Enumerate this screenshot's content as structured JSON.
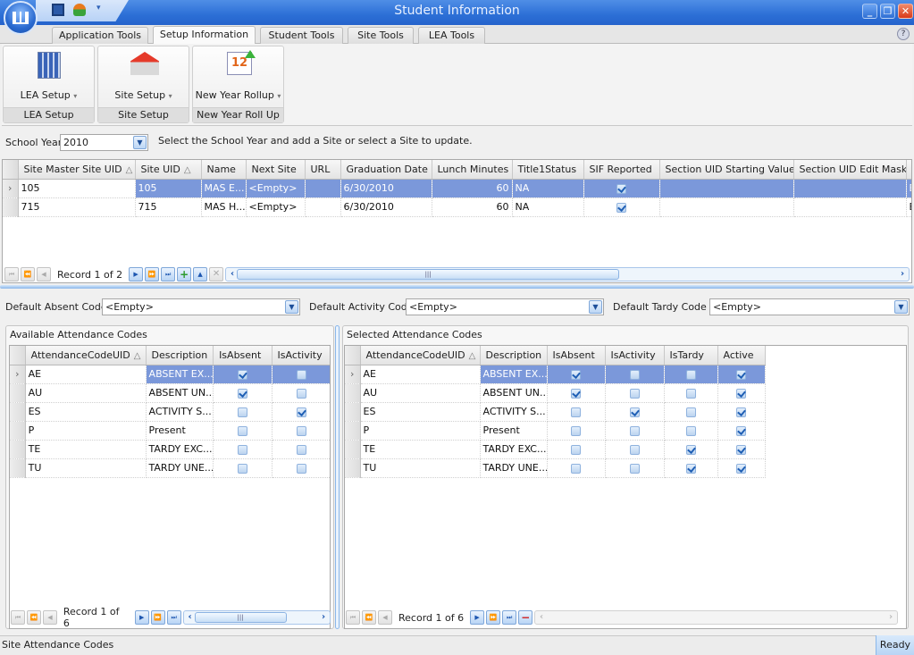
{
  "window": {
    "title": "Student Information",
    "controls": {
      "minimize": "_",
      "restore": "❐",
      "close": "✕"
    }
  },
  "quick_access": {
    "icons": [
      "save-icon",
      "user-icon",
      "customize-icon"
    ]
  },
  "tabs": [
    {
      "label": "Application Tools",
      "active": false
    },
    {
      "label": "Setup Information",
      "active": true
    },
    {
      "label": "Student Tools",
      "active": false
    },
    {
      "label": "Site Tools",
      "active": false
    },
    {
      "label": "LEA Tools",
      "active": false
    }
  ],
  "ribbon": {
    "groups": [
      {
        "button": "LEA Setup",
        "group_label": "LEA Setup",
        "icon": "building-icon"
      },
      {
        "button": "Site Setup",
        "group_label": "Site Setup",
        "icon": "houses-icon"
      },
      {
        "button": "New Year Rollup",
        "group_label": "New Year Roll Up",
        "icon": "calendar-icon"
      }
    ],
    "dropdown_glyph": "⌄"
  },
  "school_year": {
    "label": "School Year",
    "value": "2010",
    "hint": "Select the School Year and add a Site or select a Site to update."
  },
  "sites_grid": {
    "columns": [
      "Site Master Site UID",
      "Site UID",
      "Name",
      "Next Site",
      "URL",
      "Graduation Date",
      "Lunch Minutes",
      "Title1Status",
      "SIF Reported",
      "Section UID Starting Value",
      "Section UID Edit Mask",
      "G"
    ],
    "sort_glyph": "△",
    "rows": [
      {
        "master_uid": "105",
        "site_uid": "105",
        "name": "MAS E...",
        "next_site": "<Empty>",
        "url": "",
        "graduation_date": "6/30/2010",
        "lunch_minutes": "60",
        "title1": "NA",
        "sif_reported": true,
        "section_start": "",
        "section_mask": "",
        "g": "B",
        "selected": true
      },
      {
        "master_uid": "715",
        "site_uid": "715",
        "name": "MAS H...",
        "next_site": "<Empty>",
        "url": "",
        "graduation_date": "6/30/2010",
        "lunch_minutes": "60",
        "title1": "NA",
        "sif_reported": true,
        "section_start": "",
        "section_mask": "",
        "g": "B",
        "selected": false
      }
    ],
    "navigator": {
      "record_text": "Record 1 of 2"
    }
  },
  "defaults": {
    "absent": {
      "label": "Default Absent Code",
      "value": "<Empty>"
    },
    "activity": {
      "label": "Default Activity Code",
      "value": "<Empty>"
    },
    "tardy": {
      "label": "Default Tardy Code",
      "value": "<Empty>"
    }
  },
  "available_codes": {
    "title": "Available Attendance Codes",
    "columns": [
      "AttendanceCodeUID",
      "Description",
      "IsAbsent",
      "IsActivity"
    ],
    "rows": [
      {
        "uid": "AE",
        "desc": "ABSENT EX...",
        "absent": true,
        "activity": false
      },
      {
        "uid": "AU",
        "desc": "ABSENT UN...",
        "absent": true,
        "activity": false
      },
      {
        "uid": "ES",
        "desc": "ACTIVITY S...",
        "absent": false,
        "activity": true
      },
      {
        "uid": "P",
        "desc": "Present",
        "absent": false,
        "activity": false
      },
      {
        "uid": "TE",
        "desc": "TARDY EXC...",
        "absent": false,
        "activity": false
      },
      {
        "uid": "TU",
        "desc": "TARDY UNE...",
        "absent": false,
        "activity": false
      }
    ],
    "navigator": {
      "record_text": "Record 1 of 6"
    }
  },
  "selected_codes": {
    "title": "Selected Attendance Codes",
    "columns": [
      "AttendanceCodeUID",
      "Description",
      "IsAbsent",
      "IsActivity",
      "IsTardy",
      "Active"
    ],
    "rows": [
      {
        "uid": "AE",
        "desc": "ABSENT EX...",
        "absent": true,
        "activity": false,
        "tardy": false,
        "active": true
      },
      {
        "uid": "AU",
        "desc": "ABSENT UN...",
        "absent": true,
        "activity": false,
        "tardy": false,
        "active": true
      },
      {
        "uid": "ES",
        "desc": "ACTIVITY S...",
        "absent": false,
        "activity": true,
        "tardy": false,
        "active": true
      },
      {
        "uid": "P",
        "desc": "Present",
        "absent": false,
        "activity": false,
        "tardy": false,
        "active": true
      },
      {
        "uid": "TE",
        "desc": "TARDY EXC...",
        "absent": false,
        "activity": false,
        "tardy": true,
        "active": true
      },
      {
        "uid": "TU",
        "desc": "TARDY UNE...",
        "absent": false,
        "activity": false,
        "tardy": true,
        "active": true
      }
    ],
    "navigator": {
      "record_text": "Record 1 of 6"
    }
  },
  "status": {
    "left": "Site Attendance Codes",
    "right": "Ready"
  },
  "colors": {
    "title_bar": "#2c6fd6",
    "selection": "#7b98da",
    "checkbox_check": "#1f5fb5",
    "add_green": "#2e9a2e",
    "remove_red": "#d02020"
  }
}
